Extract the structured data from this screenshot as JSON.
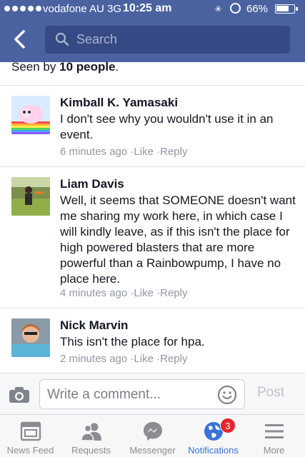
{
  "status_bar": {
    "carrier": "vodafone AU",
    "network": "3G",
    "time": "10:25 am",
    "battery": "66%"
  },
  "nav": {
    "search_placeholder": "Search"
  },
  "seen": {
    "prefix": "Seen by ",
    "count": "10 people",
    "suffix": "."
  },
  "comments": [
    {
      "author": "Kimball K. Yamasaki",
      "text": "I don't see why you wouldn't use it in an event.",
      "time": "6 minutes ago",
      "like": "Like",
      "reply": "Reply"
    },
    {
      "author": "Liam Davis",
      "text": "Well, it seems that SOMEONE doesn't want me sharing my work here, in which case I will kindly leave, as if this isn't the place for high powered blasters that are more powerful than a Rainbowpump, I have no place here.",
      "time": "4 minutes ago",
      "like": "Like",
      "reply": "Reply"
    },
    {
      "author": "Nick Marvin",
      "text": "This isn't the place for hpa.",
      "time": "2 minutes ago",
      "like": "Like",
      "reply": "Reply"
    }
  ],
  "composer": {
    "placeholder": "Write a comment...",
    "post_label": "Post"
  },
  "tabs": [
    {
      "label": "News Feed",
      "icon": "news-feed-icon"
    },
    {
      "label": "Requests",
      "icon": "friend-requests-icon"
    },
    {
      "label": "Messenger",
      "icon": "messenger-icon"
    },
    {
      "label": "Notifications",
      "icon": "globe-icon",
      "badge": "3",
      "active": true
    },
    {
      "label": "More",
      "icon": "menu-icon"
    }
  ],
  "colors": {
    "nav_bg": "#4a62a0",
    "active_tab": "#3b73d6",
    "badge": "#e4242b"
  }
}
